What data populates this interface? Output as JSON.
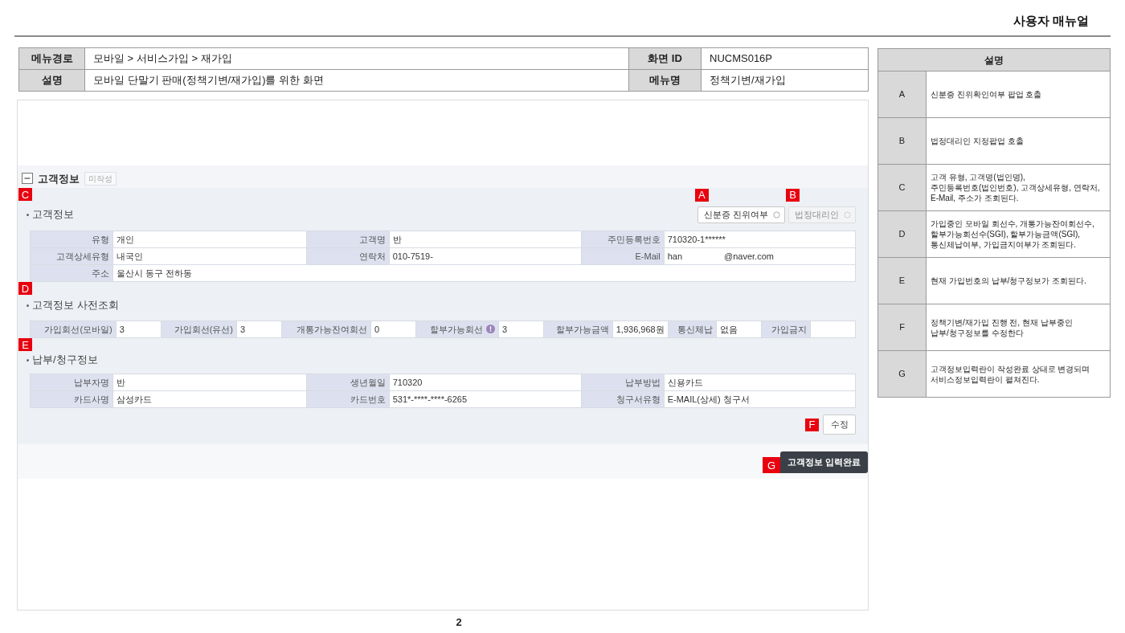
{
  "document": {
    "title": "사용자 매뉴얼",
    "page_number": "2"
  },
  "screen_info": {
    "rows": [
      [
        {
          "label": "메뉴경로",
          "value": "모바일 > 서비스가입 > 재가입"
        },
        {
          "label": "화면 ID",
          "value": "NUCMS016P"
        }
      ],
      [
        {
          "label": "설명",
          "value": "모바일 단말기 판매(정책기변/재가입)를 위한 화면"
        },
        {
          "label": "메뉴명",
          "value": "정책기변/재가입"
        }
      ]
    ]
  },
  "screen": {
    "section": {
      "title": "고객정보",
      "expanded": true,
      "status": "미작성"
    },
    "customer": {
      "marker": "C",
      "title": "고객정보",
      "buttons": [
        {
          "marker": "A",
          "label": "신분증 진위여부",
          "disabled": false
        },
        {
          "marker": "B",
          "label": "법정대리인",
          "disabled": true
        }
      ],
      "rows": [
        [
          {
            "label": "유형",
            "value": "개인"
          },
          {
            "label": "고객명",
            "value": "반"
          },
          {
            "label": "주민등록번호",
            "value": "710320-1******"
          }
        ],
        [
          {
            "label": "고객상세유형",
            "value": "내국인"
          },
          {
            "label": "연락처",
            "value": "010-7519-"
          },
          {
            "label": "E-Mail",
            "value": [
              "han",
              "@naver.com"
            ]
          }
        ],
        [
          {
            "label": "주소",
            "value": "울산시 동구 전하동"
          }
        ]
      ]
    },
    "precheck": {
      "marker": "D",
      "title": "고객정보 사전조회",
      "fields": [
        {
          "label": "가입회선(모바일)",
          "help_icon": false,
          "value": "3"
        },
        {
          "label": "가입회선(유선)",
          "help_icon": false,
          "value": "3"
        },
        {
          "label": "개통가능잔여회선",
          "help_icon": false,
          "value": "0"
        },
        {
          "label": "할부가능회선",
          "help_icon": true,
          "value": "3"
        },
        {
          "label": "할부가능금액",
          "help_icon": false,
          "value": "1,936,968원"
        },
        {
          "label": "통신체납",
          "help_icon": false,
          "value": "없음"
        },
        {
          "label": "가입금지",
          "help_icon": false
        }
      ]
    },
    "billing": {
      "marker": "E",
      "title": "납부/청구정보",
      "rows": [
        [
          {
            "label": "납부자명",
            "value": "반"
          },
          {
            "label": "생년월일",
            "value": "710320"
          },
          {
            "label": "납부방법",
            "value": "신용카드"
          }
        ],
        [
          {
            "label": "카드사명",
            "value": "삼성카드"
          },
          {
            "label": "카드번호",
            "value": "531*-****-****-6265"
          },
          {
            "label": "청구서유형",
            "value": "E-MAIL(상세) 청구서"
          }
        ]
      ],
      "edit_button": {
        "marker": "F",
        "label": "수정"
      }
    },
    "submit_button": {
      "marker": "G",
      "label": "고객정보 입력완료"
    }
  },
  "legend": {
    "title": "설명",
    "rows": [
      {
        "key": "A",
        "text": "신분증 진위확인여부 팝업 호출"
      },
      {
        "key": "B",
        "text": "법정대리인 지정팝업 호출"
      },
      {
        "key": "C",
        "text": "고객 유형, 고객명(법인명),\n주민등록번호(법인번호), 고객상세유형, 연락처, E-Mail, 주소가 조회된다."
      },
      {
        "key": "D",
        "text": "가입중인 모바일 회선수, 개통가능잔여회선수,\n할부가능회선수(SGI), 할부가능금액(SGI),\n통신체납여부, 가입금지여부가 조회된다."
      },
      {
        "key": "E",
        "text": "현재 가입번호의 납부/청구정보가 조회된다."
      },
      {
        "key": "F",
        "text": "정책기변/재가입 진행 전, 현재 납부중인\n납부/청구정보를 수정한다"
      },
      {
        "key": "G",
        "text": "고객정보입력란이 작성완료 상태로 변경되며\n서비스정보입력란이 펼쳐진다."
      }
    ]
  }
}
